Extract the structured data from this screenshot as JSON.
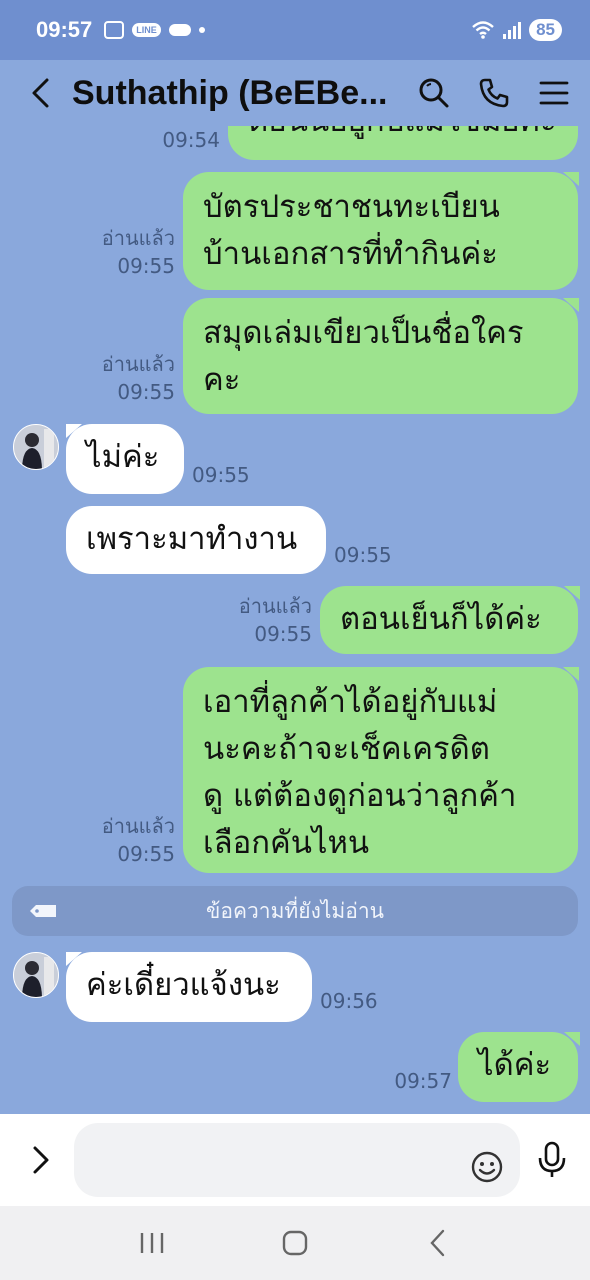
{
  "status_bar": {
    "time": "09:57",
    "line_badge": "LINE",
    "battery": "85"
  },
  "header": {
    "title": "Suthathip (BeEBe...",
    "icons": [
      "back-icon",
      "search-icon",
      "phone-icon",
      "menu-icon"
    ]
  },
  "messages": [
    {
      "side": "out",
      "text": "ตอนนี้อยู่กับแม่ใช่มั้ยคะ",
      "time": "09:54",
      "read": ""
    },
    {
      "side": "out",
      "text_lines": [
        "บัตรประชาชนทะเบียน",
        "บ้านเอกสารที่ทำกินค่ะ"
      ],
      "time": "09:55",
      "read": "อ่านแล้ว"
    },
    {
      "side": "out",
      "text_lines": [
        "สมุดเล่มเขียวเป็นชื่อใคร",
        "คะ"
      ],
      "time": "09:55",
      "read": "อ่านแล้ว"
    },
    {
      "side": "in",
      "text": "ไม่ค่ะ",
      "time": "09:55"
    },
    {
      "side": "in",
      "text": "เพราะมาทำงาน",
      "time": "09:55"
    },
    {
      "side": "out",
      "text": "ตอนเย็นก็ได้ค่ะ",
      "time": "09:55",
      "read": "อ่านแล้ว"
    },
    {
      "side": "out",
      "text_lines": [
        "เอาที่ลูกค้าได้อยู่กับแม่",
        "นะคะถ้าจะเช็คเครดิต",
        "ดู แต่ต้องดูก่อนว่าลูกค้า",
        "เลือกคันไหน"
      ],
      "time": "09:55",
      "read": "อ่านแล้ว"
    },
    {
      "side": "in",
      "text": "ค่ะเดี๋ยวแจ้งนะ",
      "time": "09:56"
    },
    {
      "side": "out",
      "text": "ได้ค่ะ",
      "time": "09:57",
      "read": ""
    }
  ],
  "unread_divider": "ข้อความที่ยังไม่อ่าน",
  "input": {
    "placeholder": ""
  },
  "colors": {
    "chat_background": "#8aa8dc",
    "outgoing_bubble": "#9de38e",
    "incoming_bubble": "#ffffff"
  }
}
